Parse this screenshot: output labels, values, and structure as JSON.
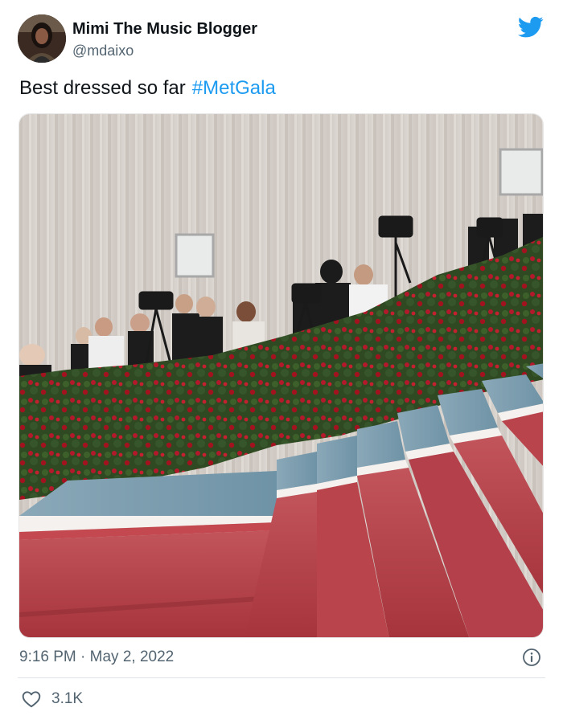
{
  "author": {
    "display_name": "Mimi The Music Blogger",
    "handle": "@mdaixo"
  },
  "tweet": {
    "text": "Best dressed so far",
    "hashtag": "#MetGala",
    "timestamp": "9:16 PM · May 2, 2022",
    "like_count": "3.1K"
  },
  "icons": {
    "brand": "twitter-bird-icon",
    "info": "info-icon",
    "like": "heart-icon"
  },
  "colors": {
    "brand_blue": "#1d9bf0",
    "secondary_text": "#536471",
    "primary_text": "#0f1419"
  }
}
